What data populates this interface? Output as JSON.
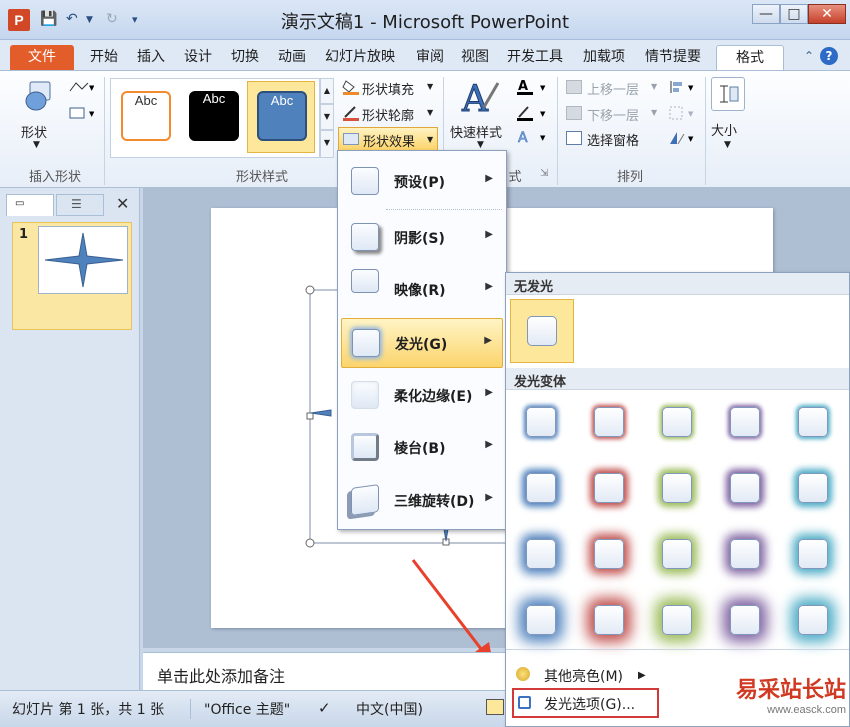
{
  "window": {
    "title": "演示文稿1 - Microsoft PowerPoint",
    "app_icon_letter": "P",
    "minimize": "—",
    "maximize": "□",
    "close": "✕"
  },
  "tabs": {
    "items": [
      "文件",
      "开始",
      "插入",
      "设计",
      "切换",
      "动画",
      "幻灯片放映",
      "审阅",
      "视图",
      "开发工具",
      "加载项",
      "情节提要",
      "格式"
    ],
    "active": "格式"
  },
  "ribbon": {
    "insert_shape": {
      "shape_label": "形状",
      "group_label": "插入形状"
    },
    "shape_styles": {
      "preset_label": "Abc",
      "fill": "形状填充",
      "outline": "形状轮廓",
      "effects": "形状效果",
      "group_label": "形状样式"
    },
    "wordart": {
      "quick_styles": "快速样式",
      "group_label_partial": "式"
    },
    "arrange": {
      "bring_forward": "上移一层",
      "send_backward": "下移一层",
      "selection_pane": "选择窗格",
      "group_label": "排列"
    },
    "size": {
      "label": "大小"
    }
  },
  "thumbnails": {
    "slide_number": "1"
  },
  "notes": {
    "placeholder": "单击此处添加备注"
  },
  "status": {
    "slide_info": "幻灯片 第 1 张，共 1 张",
    "theme": "\"Office 主题\"",
    "language": "中文(中国)"
  },
  "menu": {
    "items": [
      {
        "label": "预设(P)"
      },
      {
        "label": "阴影(S)"
      },
      {
        "label": "映像(R)"
      },
      {
        "label": "发光(G)",
        "selected": true
      },
      {
        "label": "柔化边缘(E)"
      },
      {
        "label": "棱台(B)"
      },
      {
        "label": "三维旋转(D)"
      }
    ]
  },
  "glow_gallery": {
    "no_glow_header": "无发光",
    "variants_header": "发光变体",
    "colors": [
      "#4f81bd",
      "#c0504d",
      "#9bbb59",
      "#8064a2",
      "#4bacc6"
    ],
    "more_colors": "其他亮色(M)",
    "glow_options": "发光选项(G)..."
  },
  "watermark": {
    "text": "易采站长站",
    "url": "www.easck.com"
  }
}
